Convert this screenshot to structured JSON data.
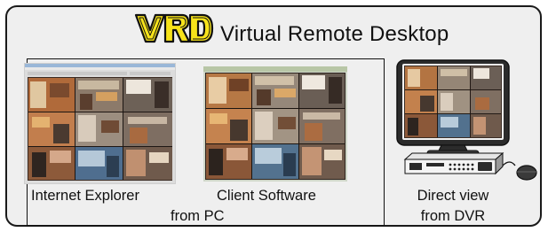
{
  "header": {
    "logo_text": "VRD",
    "title": "Virtual Remote Desktop"
  },
  "sources": [
    {
      "label": "Internet Explorer"
    },
    {
      "label": "Client Software"
    }
  ],
  "pc_group_label": "from PC",
  "dvr": {
    "line1": "Direct view",
    "line2": "from DVR"
  },
  "colors": {
    "logo_yellow": "#f7e31a",
    "panel_background": "#efefef",
    "border": "#1a1a1a",
    "monitor_body": "#2b2b2b"
  }
}
